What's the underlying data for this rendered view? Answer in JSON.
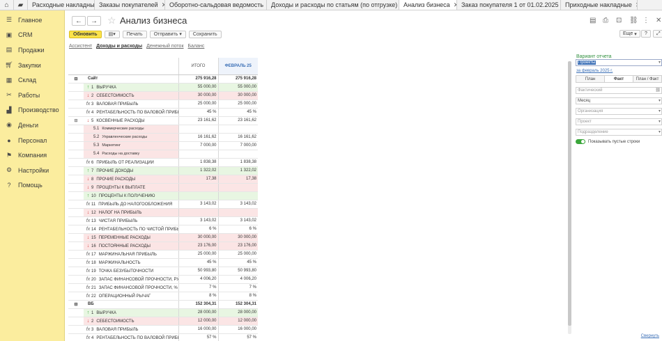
{
  "tabs": [
    {
      "label": "Расходные накладные"
    },
    {
      "label": "Заказы покупателей"
    },
    {
      "label": "Оборотно-сальдовая ведомость"
    },
    {
      "label": "Доходы и расходы по статьям (по отгрузке)"
    },
    {
      "label": "Анализ бизнеса"
    },
    {
      "label": "Заказ покупателя 1 от 01.02.2025"
    },
    {
      "label": "Приходные накладные"
    }
  ],
  "sidebar": {
    "items": [
      {
        "label": "Главное",
        "icon": "menu-icon"
      },
      {
        "label": "CRM",
        "icon": "crm-icon"
      },
      {
        "label": "Продажи",
        "icon": "sales-icon"
      },
      {
        "label": "Закупки",
        "icon": "purchases-icon"
      },
      {
        "label": "Склад",
        "icon": "warehouse-icon"
      },
      {
        "label": "Работы",
        "icon": "works-icon"
      },
      {
        "label": "Производство",
        "icon": "production-icon"
      },
      {
        "label": "Деньги",
        "icon": "money-icon"
      },
      {
        "label": "Персонал",
        "icon": "personnel-icon"
      },
      {
        "label": "Компания",
        "icon": "company-icon"
      },
      {
        "label": "Настройки",
        "icon": "settings-icon"
      },
      {
        "label": "Помощь",
        "icon": "help-icon"
      }
    ]
  },
  "header": {
    "title": "Анализ бизнеса"
  },
  "toolbar": {
    "refresh": "Обновить",
    "print": "Печать",
    "send": "Отправить",
    "save": "Сохранить",
    "more": "Еще",
    "help": "?"
  },
  "view_tabs": [
    {
      "label": "Ассистент"
    },
    {
      "label": "Доходы и расходы"
    },
    {
      "label": "Денежный поток"
    },
    {
      "label": "Баланс"
    }
  ],
  "report": {
    "col_total": "ИТОГО",
    "col_month": "ФЕВРАЛЬ 25",
    "rows": [
      {
        "kind": "grp",
        "ind": "",
        "num": "",
        "label": "Сайт",
        "total": "275 916,28",
        "month": "275 916,28"
      },
      {
        "kind": "pos",
        "ind": "up",
        "num": "1",
        "label": "ВЫРУЧКА",
        "total": "55 000,00",
        "month": "55 000,00"
      },
      {
        "kind": "neg",
        "ind": "down",
        "num": "2",
        "label": "СЕБЕСТОИМОСТЬ",
        "total": "30 000,00",
        "month": "30 000,00"
      },
      {
        "kind": "norm",
        "ind": "fx",
        "num": "3",
        "label": "ВАЛОВАЯ ПРИБЫЛЬ",
        "total": "25 000,00",
        "month": "25 000,00"
      },
      {
        "kind": "norm",
        "ind": "fx",
        "num": "4",
        "label": "РЕНТАБЕЛЬНОСТЬ ПО ВАЛОВОЙ ПРИБЫЛИ",
        "total": "45 %",
        "month": "45 %"
      },
      {
        "kind": "norm",
        "ind": "down",
        "num": "5",
        "label": "КОСВЕННЫЕ РАСХОДЫ",
        "total": "23 161,62",
        "month": "23 161,62"
      },
      {
        "kind": "sub",
        "ind": "",
        "num": "5.1",
        "label": "Коммерческие расходы",
        "total": "",
        "month": ""
      },
      {
        "kind": "sub",
        "ind": "",
        "num": "5.2",
        "label": "Управленческие расходы",
        "total": "16 161,62",
        "month": "16 161,62"
      },
      {
        "kind": "sub",
        "ind": "",
        "num": "5.3",
        "label": "Маркетинг",
        "total": "7 000,00",
        "month": "7 000,00"
      },
      {
        "kind": "sub",
        "ind": "",
        "num": "5.4",
        "label": "Расходы на доставку",
        "total": "",
        "month": ""
      },
      {
        "kind": "norm",
        "ind": "fx",
        "num": "6",
        "label": "ПРИБЫЛЬ ОТ РЕАЛИЗАЦИИ",
        "total": "1 838,38",
        "month": "1 838,38"
      },
      {
        "kind": "pos",
        "ind": "up",
        "num": "7",
        "label": "ПРОЧИЕ ДОХОДЫ",
        "total": "1 322,02",
        "month": "1 322,02"
      },
      {
        "kind": "neg",
        "ind": "down",
        "num": "8",
        "label": "ПРОЧИЕ РАСХОДЫ",
        "total": "17,38",
        "month": "17,38"
      },
      {
        "kind": "neg",
        "ind": "down",
        "num": "9",
        "label": "ПРОЦЕНТЫ К ВЫПЛАТЕ",
        "total": "",
        "month": ""
      },
      {
        "kind": "pos",
        "ind": "up",
        "num": "10",
        "label": "ПРОЦЕНТЫ К ПОЛУЧЕНИЮ",
        "total": "",
        "month": ""
      },
      {
        "kind": "norm",
        "ind": "fx",
        "num": "11",
        "label": "ПРИБЫЛЬ ДО НАЛОГООБЛОЖЕНИЯ",
        "total": "3 143,02",
        "month": "3 143,02"
      },
      {
        "kind": "neg",
        "ind": "down",
        "num": "12",
        "label": "НАЛОГ НА ПРИБЫЛЬ",
        "total": "",
        "month": ""
      },
      {
        "kind": "norm",
        "ind": "fx",
        "num": "13",
        "label": "ЧИСТАЯ ПРИБЫЛЬ",
        "total": "3 143,02",
        "month": "3 143,02"
      },
      {
        "kind": "norm",
        "ind": "fx",
        "num": "14",
        "label": "РЕНТАБЕЛЬНОСТЬ ПО ЧИСТОЙ ПРИБЫЛИ",
        "total": "6 %",
        "month": "6 %"
      },
      {
        "kind": "neg",
        "ind": "down",
        "num": "15",
        "label": "ПЕРЕМЕННЫЕ РАСХОДЫ",
        "total": "30 000,00",
        "month": "30 000,00"
      },
      {
        "kind": "neg",
        "ind": "down",
        "num": "16",
        "label": "ПОСТОЯННЫЕ РАСХОДЫ",
        "total": "23 176,00",
        "month": "23 176,00"
      },
      {
        "kind": "norm",
        "ind": "fx",
        "num": "17",
        "label": "МАРЖИНАЛЬНАЯ ПРИБЫЛЬ",
        "total": "25 000,00",
        "month": "25 000,00"
      },
      {
        "kind": "norm",
        "ind": "fx",
        "num": "18",
        "label": "МАРЖИНАЛЬНОСТЬ",
        "total": "45 %",
        "month": "45 %"
      },
      {
        "kind": "norm",
        "ind": "fx",
        "num": "19",
        "label": "ТОЧКА БЕЗУБЫТОЧНОСТИ",
        "total": "50 993,80",
        "month": "50 993,80"
      },
      {
        "kind": "norm",
        "ind": "fx",
        "num": "20",
        "label": "ЗАПАС ФИНАНСОВОЙ ПРОЧНОСТИ, РУБ.",
        "total": "4 006,20",
        "month": "4 006,20"
      },
      {
        "kind": "norm",
        "ind": "fx",
        "num": "21",
        "label": "ЗАПАС ФИНАНСОВОЙ ПРОЧНОСТИ, %",
        "total": "7 %",
        "month": "7 %"
      },
      {
        "kind": "norm",
        "ind": "fx",
        "num": "22",
        "label": "ОПЕРАЦИОННЫЙ РЫЧАГ",
        "total": "8 %",
        "month": "8 %"
      },
      {
        "kind": "grp",
        "ind": "",
        "num": "",
        "label": "ВБ",
        "total": "152 304,31",
        "month": "152 304,31"
      },
      {
        "kind": "pos",
        "ind": "up",
        "num": "1",
        "label": "ВЫРУЧКА",
        "total": "28 000,00",
        "month": "28 000,00"
      },
      {
        "kind": "neg",
        "ind": "down",
        "num": "2",
        "label": "СЕБЕСТОИМОСТЬ",
        "total": "12 000,00",
        "month": "12 000,00"
      },
      {
        "kind": "norm",
        "ind": "fx",
        "num": "3",
        "label": "ВАЛОВАЯ ПРИБЫЛЬ",
        "total": "16 000,00",
        "month": "16 000,00"
      },
      {
        "kind": "norm",
        "ind": "fx",
        "num": "4",
        "label": "РЕНТАБЕЛЬНОСТЬ ПО ВАЛОВОЙ ПРИБЫЛИ",
        "total": "57 %",
        "month": "57 %"
      }
    ]
  },
  "panel": {
    "variant_label": "Вариант отчета",
    "variant_value": "Проекты",
    "period": "за февраль 2025 г.",
    "seg": [
      "План",
      "Факт",
      "План / Факт"
    ],
    "f1": "Фактический",
    "f2": "Месяц",
    "f3": "Организация",
    "f4": "Проект",
    "f5": "Подразделение",
    "toggle_label": "Показывать пустые строки",
    "collapse": "Свернуть"
  },
  "colors": {
    "accent": "#fce349",
    "sidebar": "#fbed9e",
    "positive": "#e8f6e2",
    "negative": "#fbe5e5",
    "link": "#3b6fb6"
  }
}
